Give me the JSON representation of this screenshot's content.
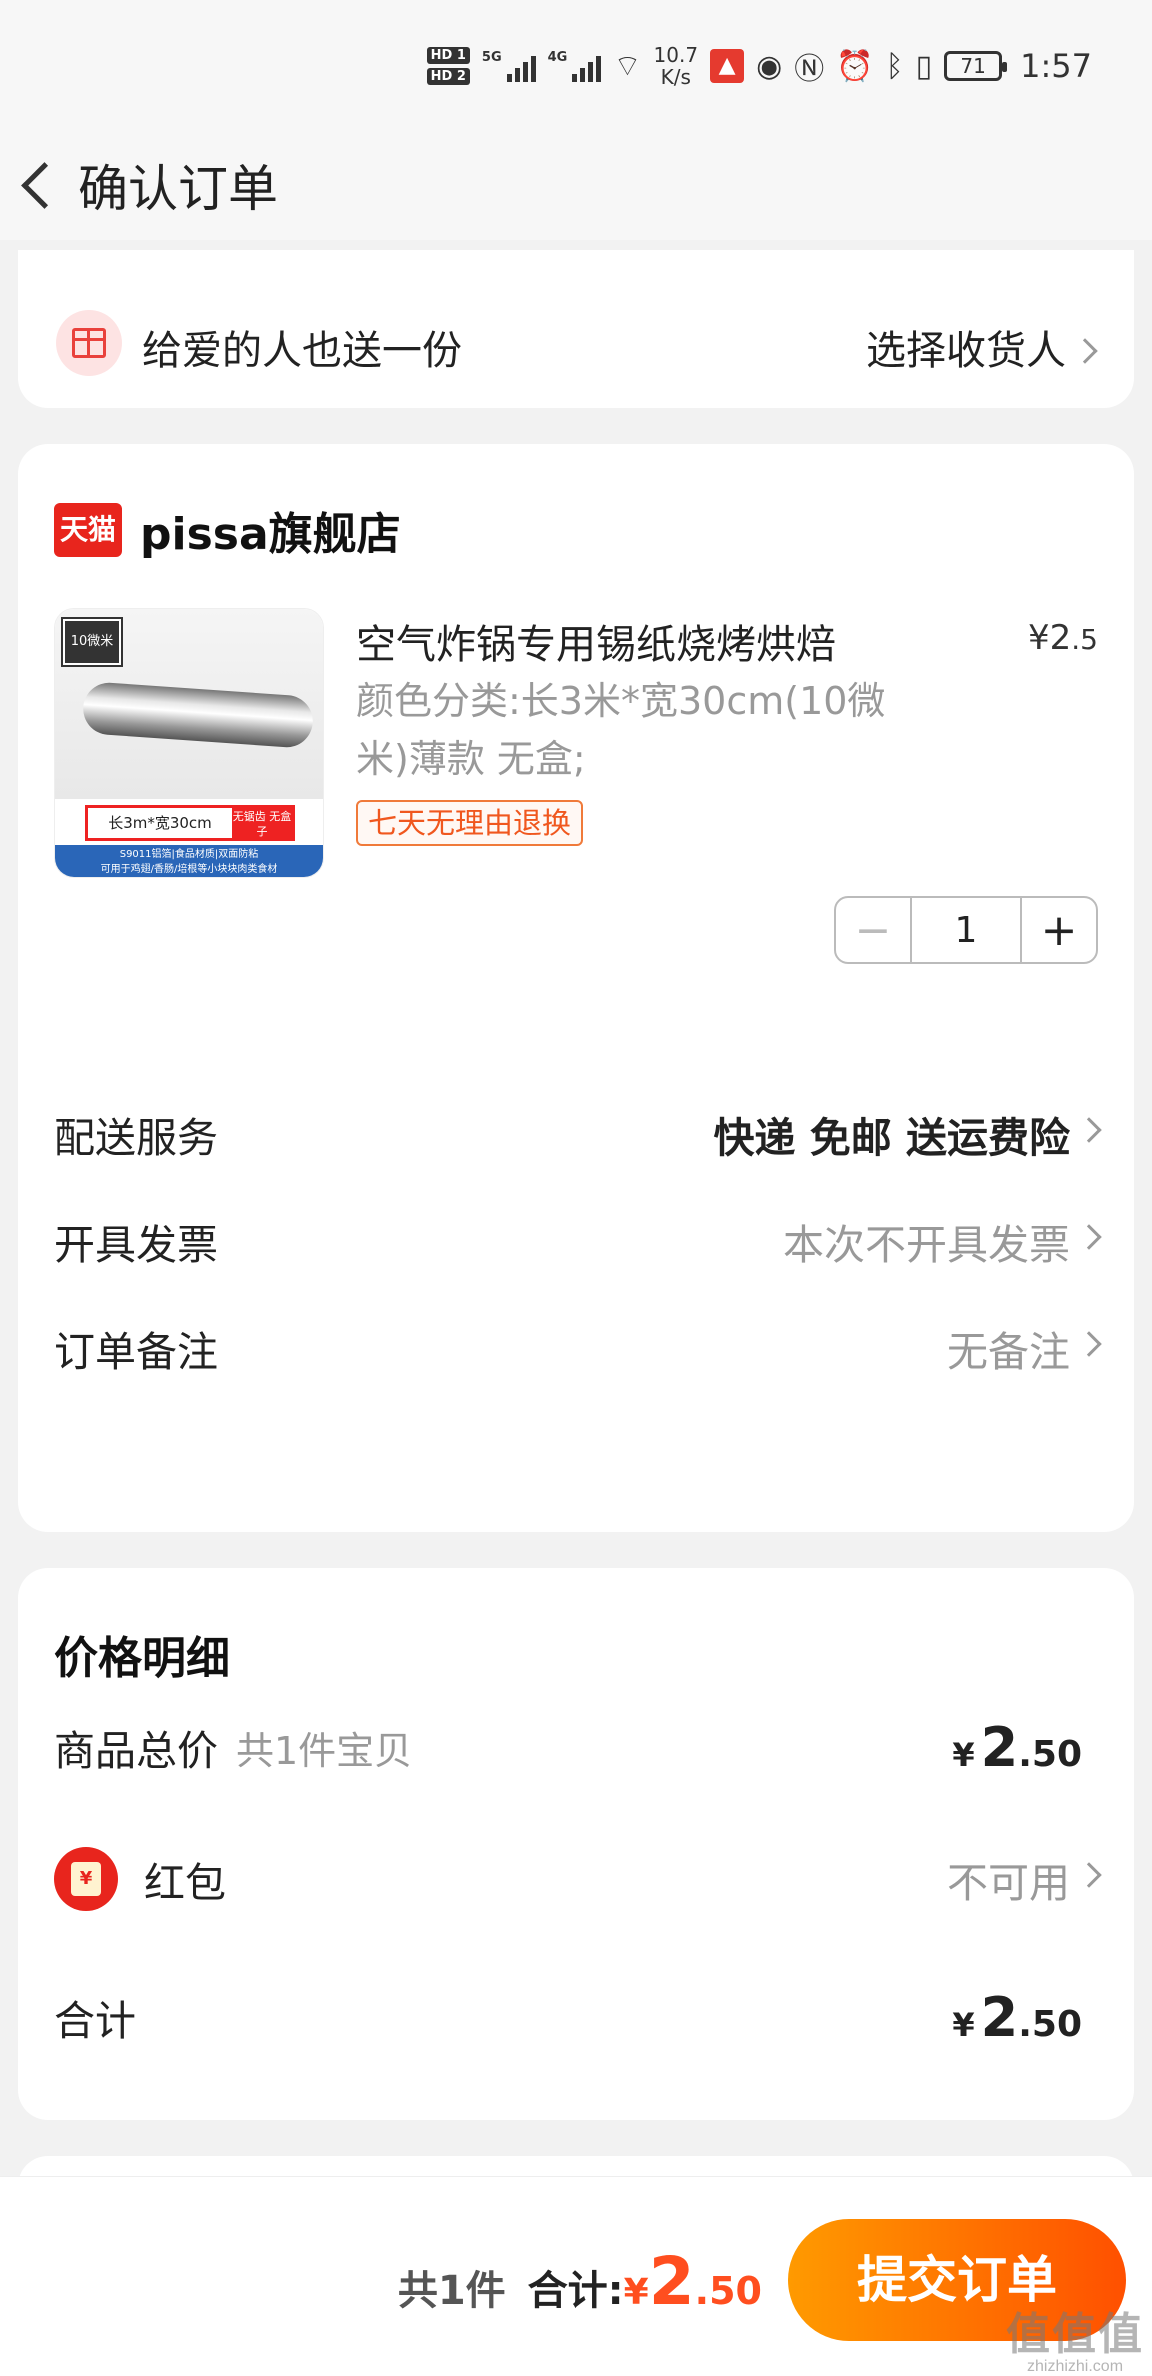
{
  "status_bar": {
    "hd1": "HD 1",
    "hd2": "HD 2",
    "sig1": "5G",
    "sig2": "4G",
    "speed_value": "10.7",
    "speed_unit": "K/s",
    "battery": "71",
    "time": "1:57"
  },
  "header": {
    "title": "确认订单"
  },
  "gift": {
    "text": "给爱的人也送一份",
    "action": "选择收货人"
  },
  "store": {
    "logo_text": "天猫",
    "name": "pissa旗舰店"
  },
  "product": {
    "image_tag": "10微米",
    "image_label_main": "长3m*宽30cm",
    "image_label_side": "无锯齿 无盒子",
    "image_footer_1": "S9011铝箔|食品材质|双面防粘",
    "image_footer_2": "可用于鸡翅/香肠/培根等小块块肉类食材",
    "title": "空气炸锅专用锡纸烧烤烘焙",
    "price_currency": "¥",
    "price_int": "2",
    "price_dec": ".5",
    "spec_line1": "颜色分类:长3米*宽30cm(10微",
    "spec_line2": "米)薄款 无盒;",
    "badge": "七天无理由退换",
    "quantity": "1",
    "minus": "−",
    "plus": "+"
  },
  "options": [
    {
      "label": "配送服务",
      "value": "快递 免邮 送运费险"
    },
    {
      "label": "开具发票",
      "value": "本次不开具发票"
    },
    {
      "label": "订单备注",
      "value": "无备注"
    }
  ],
  "price_detail": {
    "title": "价格明细",
    "goods_label": "商品总价",
    "goods_sub": "共1件宝贝",
    "goods_cur": "¥",
    "goods_int": "2",
    "goods_dec": ".50",
    "redpack_icon": "¥",
    "redpack_label": "红包",
    "redpack_value": "不可用",
    "total_label": "合计",
    "total_cur": "¥",
    "total_int": "2",
    "total_dec": ".50"
  },
  "bottom": {
    "count": "共1件",
    "total_label": "合计:",
    "cur": "¥",
    "int": "2",
    "dec": ".50",
    "submit": "提交订单"
  },
  "watermark": {
    "main": "值值值",
    "sub": "zhizhizhi.com"
  },
  "colors": {
    "accent": "#ff5000",
    "brand_red": "#e8251d",
    "muted": "#999999"
  }
}
